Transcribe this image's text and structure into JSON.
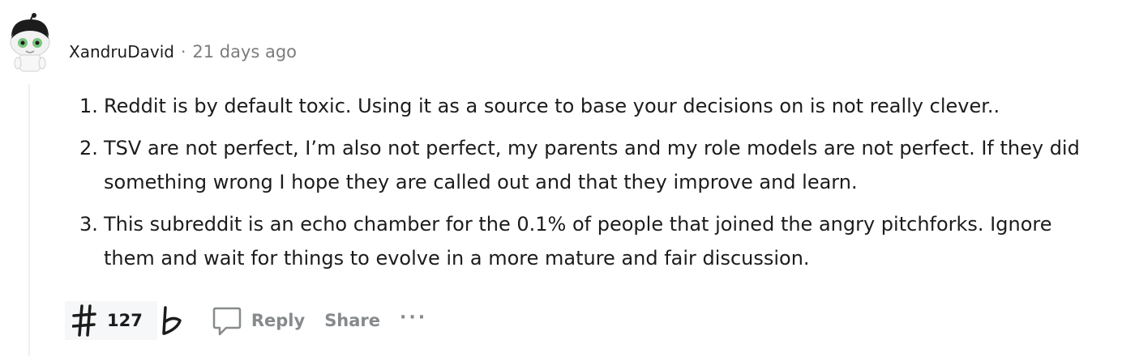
{
  "comment": {
    "author": "XandruDavid",
    "separator": "·",
    "time": "21 days ago",
    "avatar_icon": "snoo-avatar-icon",
    "items": [
      {
        "num": "1.",
        "text": "Reddit is by default toxic. Using it as a source to base your decisions on is not really clever.."
      },
      {
        "num": "2.",
        "text": "TSV are not perfect, I’m also not perfect, my parents and my role models are not perfect. If they did something wrong I hope they are called out and that they improve and learn."
      },
      {
        "num": "3.",
        "text": "This subreddit is an echo chamber for the 0.1% of people that joined the angry pitchforks. Ignore them and wait for things to evolve in a more mature and fair discussion."
      }
    ]
  },
  "actions": {
    "upvote_icon": "hash-upvote-icon",
    "score": "127",
    "downvote_icon": "flat-downvote-icon",
    "reply_icon": "speech-bubble-icon",
    "reply_label": "Reply",
    "share_label": "Share",
    "more_label": "···"
  },
  "colors": {
    "text": "#1c1c1c",
    "meta": "#7c7c7c",
    "action": "#878a8c",
    "thread_line": "#edeff1",
    "vote_bg": "#f6f7f8"
  }
}
